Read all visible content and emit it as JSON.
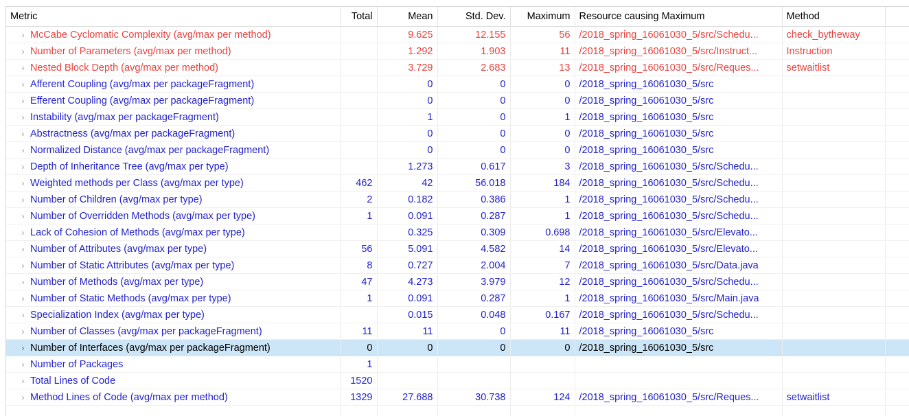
{
  "view": {
    "name": "metrics-table-view",
    "accent_selected_bg": "#cde6f7",
    "color_red": "#e8413c",
    "color_blue": "#2222cc",
    "chevron_glyph": "›"
  },
  "columns": [
    {
      "key": "metric",
      "label": "Metric",
      "align": "left"
    },
    {
      "key": "total",
      "label": "Total",
      "align": "right"
    },
    {
      "key": "mean",
      "label": "Mean",
      "align": "right"
    },
    {
      "key": "std",
      "label": "Std. Dev.",
      "align": "right"
    },
    {
      "key": "max",
      "label": "Maximum",
      "align": "right"
    },
    {
      "key": "resource",
      "label": "Resource causing Maximum",
      "align": "left"
    },
    {
      "key": "method",
      "label": "Method",
      "align": "left"
    }
  ],
  "rows": [
    {
      "metric": "McCabe Cyclomatic Complexity (avg/max per method)",
      "total": "",
      "mean": "9.625",
      "std": "12.155",
      "max": "56",
      "resource": "/2018_spring_16061030_5/src/Schedu...",
      "method": "check_bytheway",
      "color": "red",
      "selected": false
    },
    {
      "metric": "Number of Parameters (avg/max per method)",
      "total": "",
      "mean": "1.292",
      "std": "1.903",
      "max": "11",
      "resource": "/2018_spring_16061030_5/src/Instruct...",
      "method": "Instruction",
      "color": "red",
      "selected": false
    },
    {
      "metric": "Nested Block Depth (avg/max per method)",
      "total": "",
      "mean": "3.729",
      "std": "2.683",
      "max": "13",
      "resource": "/2018_spring_16061030_5/src/Reques...",
      "method": "setwaitlist",
      "color": "red",
      "selected": false
    },
    {
      "metric": "Afferent Coupling (avg/max per packageFragment)",
      "total": "",
      "mean": "0",
      "std": "0",
      "max": "0",
      "resource": "/2018_spring_16061030_5/src",
      "method": "",
      "color": "blue",
      "selected": false
    },
    {
      "metric": "Efferent Coupling (avg/max per packageFragment)",
      "total": "",
      "mean": "0",
      "std": "0",
      "max": "0",
      "resource": "/2018_spring_16061030_5/src",
      "method": "",
      "color": "blue",
      "selected": false
    },
    {
      "metric": "Instability (avg/max per packageFragment)",
      "total": "",
      "mean": "1",
      "std": "0",
      "max": "1",
      "resource": "/2018_spring_16061030_5/src",
      "method": "",
      "color": "blue",
      "selected": false
    },
    {
      "metric": "Abstractness (avg/max per packageFragment)",
      "total": "",
      "mean": "0",
      "std": "0",
      "max": "0",
      "resource": "/2018_spring_16061030_5/src",
      "method": "",
      "color": "blue",
      "selected": false
    },
    {
      "metric": "Normalized Distance (avg/max per packageFragment)",
      "total": "",
      "mean": "0",
      "std": "0",
      "max": "0",
      "resource": "/2018_spring_16061030_5/src",
      "method": "",
      "color": "blue",
      "selected": false
    },
    {
      "metric": "Depth of Inheritance Tree (avg/max per type)",
      "total": "",
      "mean": "1.273",
      "std": "0.617",
      "max": "3",
      "resource": "/2018_spring_16061030_5/src/Schedu...",
      "method": "",
      "color": "blue",
      "selected": false
    },
    {
      "metric": "Weighted methods per Class (avg/max per type)",
      "total": "462",
      "mean": "42",
      "std": "56.018",
      "max": "184",
      "resource": "/2018_spring_16061030_5/src/Schedu...",
      "method": "",
      "color": "blue",
      "selected": false
    },
    {
      "metric": "Number of Children (avg/max per type)",
      "total": "2",
      "mean": "0.182",
      "std": "0.386",
      "max": "1",
      "resource": "/2018_spring_16061030_5/src/Schedu...",
      "method": "",
      "color": "blue",
      "selected": false
    },
    {
      "metric": "Number of Overridden Methods (avg/max per type)",
      "total": "1",
      "mean": "0.091",
      "std": "0.287",
      "max": "1",
      "resource": "/2018_spring_16061030_5/src/Schedu...",
      "method": "",
      "color": "blue",
      "selected": false
    },
    {
      "metric": "Lack of Cohesion of Methods (avg/max per type)",
      "total": "",
      "mean": "0.325",
      "std": "0.309",
      "max": "0.698",
      "resource": "/2018_spring_16061030_5/src/Elevato...",
      "method": "",
      "color": "blue",
      "selected": false
    },
    {
      "metric": "Number of Attributes (avg/max per type)",
      "total": "56",
      "mean": "5.091",
      "std": "4.582",
      "max": "14",
      "resource": "/2018_spring_16061030_5/src/Elevato...",
      "method": "",
      "color": "blue",
      "selected": false
    },
    {
      "metric": "Number of Static Attributes (avg/max per type)",
      "total": "8",
      "mean": "0.727",
      "std": "2.004",
      "max": "7",
      "resource": "/2018_spring_16061030_5/src/Data.java",
      "method": "",
      "color": "blue",
      "selected": false
    },
    {
      "metric": "Number of Methods (avg/max per type)",
      "total": "47",
      "mean": "4.273",
      "std": "3.979",
      "max": "12",
      "resource": "/2018_spring_16061030_5/src/Schedu...",
      "method": "",
      "color": "blue",
      "selected": false
    },
    {
      "metric": "Number of Static Methods (avg/max per type)",
      "total": "1",
      "mean": "0.091",
      "std": "0.287",
      "max": "1",
      "resource": "/2018_spring_16061030_5/src/Main.java",
      "method": "",
      "color": "blue",
      "selected": false
    },
    {
      "metric": "Specialization Index (avg/max per type)",
      "total": "",
      "mean": "0.015",
      "std": "0.048",
      "max": "0.167",
      "resource": "/2018_spring_16061030_5/src/Schedu...",
      "method": "",
      "color": "blue",
      "selected": false
    },
    {
      "metric": "Number of Classes (avg/max per packageFragment)",
      "total": "11",
      "mean": "11",
      "std": "0",
      "max": "11",
      "resource": "/2018_spring_16061030_5/src",
      "method": "",
      "color": "blue",
      "selected": false
    },
    {
      "metric": "Number of Interfaces (avg/max per packageFragment)",
      "total": "0",
      "mean": "0",
      "std": "0",
      "max": "0",
      "resource": "/2018_spring_16061030_5/src",
      "method": "",
      "color": "blue",
      "selected": true
    },
    {
      "metric": "Number of Packages",
      "total": "1",
      "mean": "",
      "std": "",
      "max": "",
      "resource": "",
      "method": "",
      "color": "blue",
      "selected": false
    },
    {
      "metric": "Total Lines of Code",
      "total": "1520",
      "mean": "",
      "std": "",
      "max": "",
      "resource": "",
      "method": "",
      "color": "blue",
      "selected": false
    },
    {
      "metric": "Method Lines of Code (avg/max per method)",
      "total": "1329",
      "mean": "27.688",
      "std": "30.738",
      "max": "124",
      "resource": "/2018_spring_16061030_5/src/Reques...",
      "method": "setwaitlist",
      "color": "blue",
      "selected": false
    }
  ]
}
